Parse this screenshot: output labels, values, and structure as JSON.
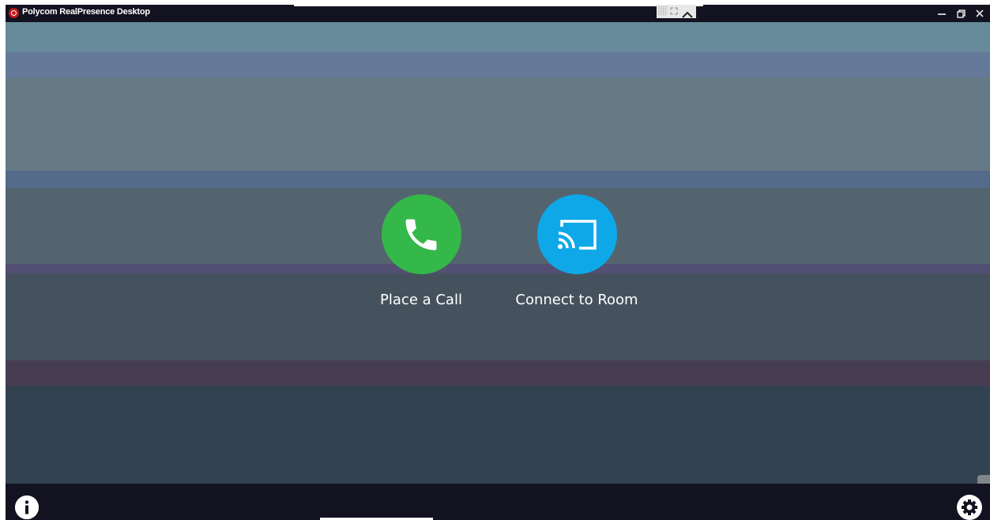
{
  "window": {
    "title": "Polycom RealPresence Desktop"
  },
  "top_controls": {
    "icons": [
      "grid-icon",
      "expand-icon",
      "chevron-up-icon"
    ]
  },
  "window_controls": {
    "minimize_icon": "minimize-icon",
    "restore_icon": "restore-icon",
    "close_icon": "close-icon"
  },
  "main": {
    "actions": [
      {
        "label": "Place a Call",
        "icon": "phone-icon",
        "color": "#35b84a"
      },
      {
        "label": "Connect to Room",
        "icon": "cast-icon",
        "color": "#0ea8e9"
      }
    ]
  },
  "bottom": {
    "info_icon": "info-icon",
    "settings_icon": "gear-icon"
  }
}
